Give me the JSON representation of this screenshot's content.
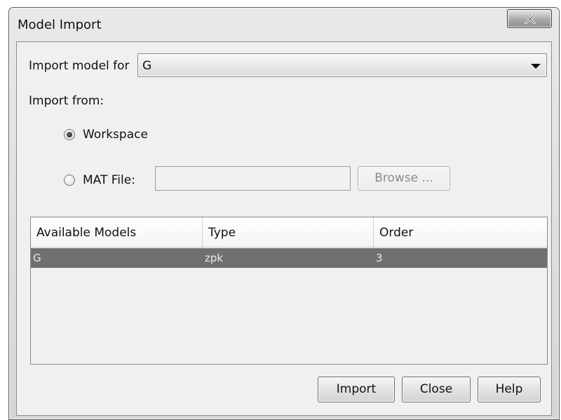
{
  "window": {
    "title": "Model Import"
  },
  "import_for": {
    "label": "Import model for",
    "value": "G"
  },
  "import_from": {
    "label": "Import from:",
    "options": [
      {
        "label": "Workspace",
        "selected": true
      },
      {
        "label": "MAT File:",
        "selected": false
      }
    ],
    "mat_file_value": "",
    "browse_label": "Browse ..."
  },
  "models_table": {
    "columns": [
      "Available Models",
      "Type",
      "Order"
    ],
    "rows": [
      {
        "name": "G",
        "type": "zpk",
        "order": "3",
        "selected": true
      }
    ]
  },
  "buttons": {
    "import": "Import",
    "close": "Close",
    "help": "Help"
  },
  "colors": {
    "selected_row": "#707070",
    "dialog_background": "#f0f0f0"
  },
  "icons": {
    "title_close": "close-icon",
    "dropdown": "chevron-down-icon"
  }
}
